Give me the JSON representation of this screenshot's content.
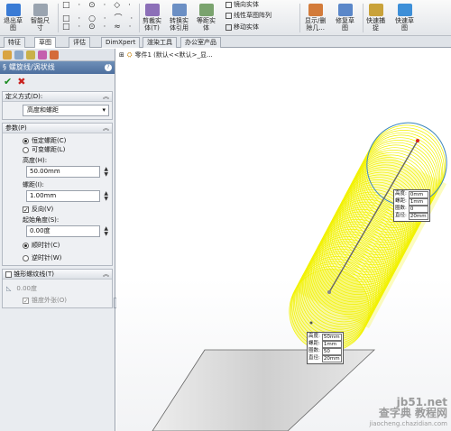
{
  "ribbon": {
    "buttons": [
      {
        "label": "退出草\n图",
        "name": "exit-sketch-button"
      },
      {
        "label": "智能尺\n寸",
        "name": "smart-dimension-button"
      },
      {
        "label": "剪裁实\n体(T)",
        "name": "trim-entities-button"
      },
      {
        "label": "转换实\n体引用",
        "name": "convert-entities-button"
      },
      {
        "label": "等距实\n体",
        "name": "offset-entities-button"
      },
      {
        "label": "显示/删\n除几...",
        "name": "display-delete-relations-button"
      },
      {
        "label": "修复草\n图",
        "name": "repair-sketch-button"
      },
      {
        "label": "快速捕\n捉",
        "name": "quick-snaps-button"
      },
      {
        "label": "快速草\n图",
        "name": "rapid-sketch-button"
      }
    ],
    "mirror_label": "镜向实体",
    "linear_pattern_label": "线性草图阵列",
    "move_label": "移动实体"
  },
  "tabs": [
    "特征",
    "草图",
    "评估",
    "DimXpert",
    "渲染工具",
    "办公室产品"
  ],
  "active_tab": "草图",
  "panel": {
    "title": "螺旋线/涡状线",
    "help": "?",
    "definition": {
      "header": "定义方式(D):",
      "selected": "高度和螺距"
    },
    "params": {
      "header": "参数(P)",
      "constant_pitch": "恒定螺距(C)",
      "variable_pitch": "可变螺距(L)",
      "height_label": "高度(H):",
      "height_value": "50.00mm",
      "pitch_label": "螺距(I):",
      "pitch_value": "1.00mm",
      "reverse_label": "反向(V)",
      "start_angle_label": "起始角度(S):",
      "start_angle_value": "0.00度",
      "clockwise_label": "顺时针(C)",
      "counter_clockwise_label": "逆时针(W)"
    },
    "taper": {
      "header": "锥形螺纹线(T)",
      "angle_value": "0.00度",
      "outward_label": "锥度外张(O)"
    }
  },
  "viewport": {
    "tree_label": "零件1  (默认<<默认>_显..."
  },
  "callout_top": {
    "rows": [
      {
        "k": "高度:",
        "v": "0mm"
      },
      {
        "k": "螺距:",
        "v": "1mm"
      },
      {
        "k": "圈数:",
        "v": "0"
      },
      {
        "k": "直径:",
        "v": "20mm"
      }
    ]
  },
  "callout_bottom": {
    "rows": [
      {
        "k": "高度:",
        "v": "50mm"
      },
      {
        "k": "螺距:",
        "v": "1mm"
      },
      {
        "k": "圈数:",
        "v": "50"
      },
      {
        "k": "直径:",
        "v": "20mm"
      }
    ]
  },
  "watermark": {
    "line1": "查字典 教程网",
    "line2": "jiaocheng.chazidian.com",
    "site": "jb51.net"
  },
  "colors": {
    "helix": "#f2f200",
    "accent": "#4d6f9e",
    "cylinder": "#d8d8d8"
  }
}
